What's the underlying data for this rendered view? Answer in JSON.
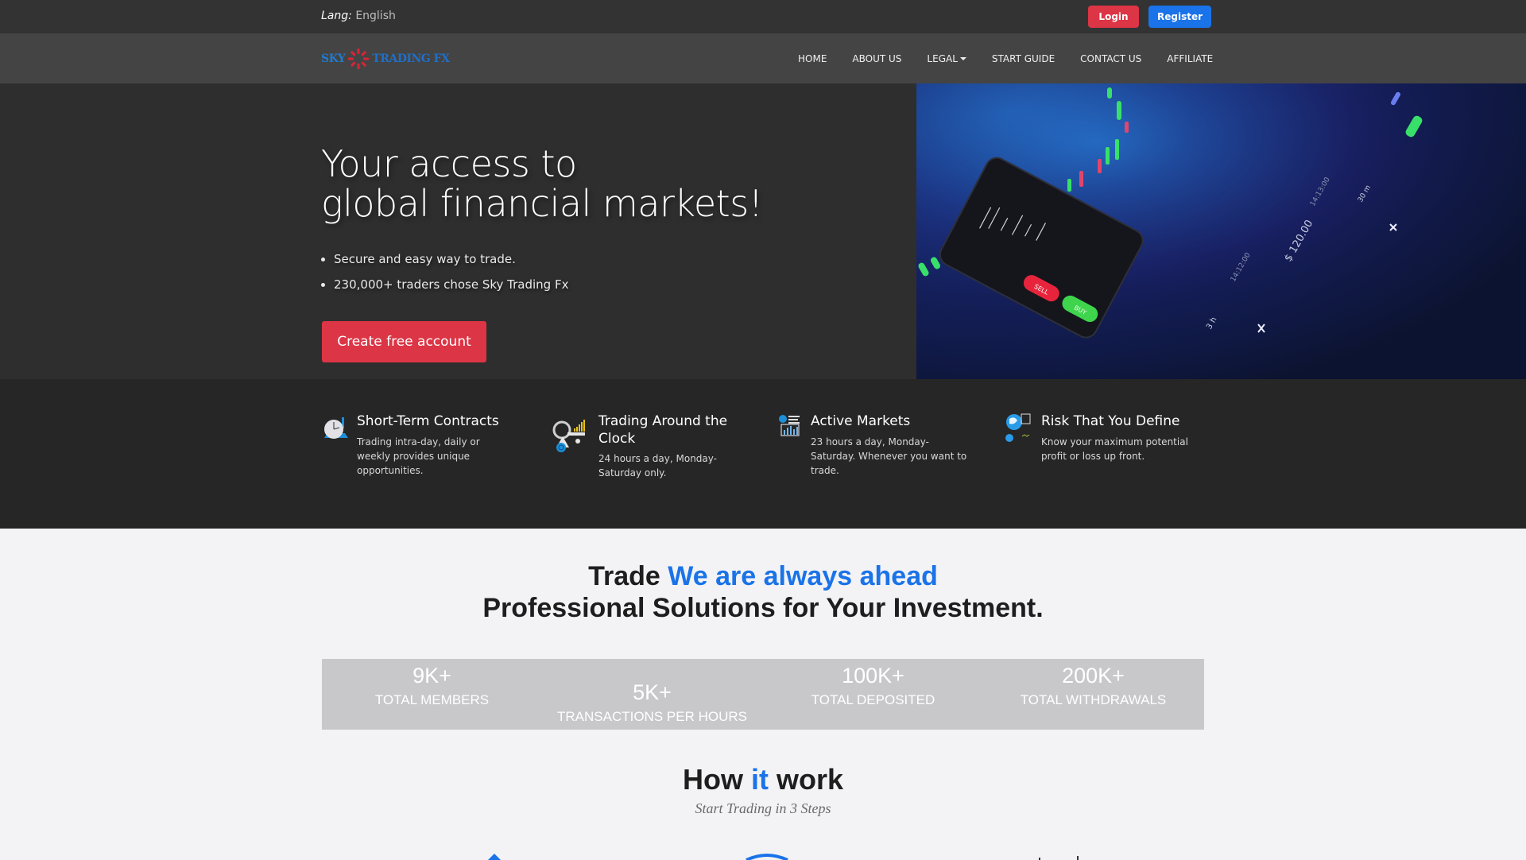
{
  "topbar": {
    "lang_label": "Lang:",
    "lang_value": "English",
    "login_label": "Login",
    "register_label": "Register"
  },
  "brand": {
    "logo_part1": "SKY",
    "logo_part2": "TRADING FX",
    "colors": {
      "primary": "#1a73e8",
      "danger": "#dc3545"
    }
  },
  "nav": {
    "items": [
      {
        "label": "HOME"
      },
      {
        "label": "ABOUT US"
      },
      {
        "label": "LEGAL",
        "has_dropdown": true
      },
      {
        "label": "START GUIDE"
      },
      {
        "label": "CONTACT US"
      },
      {
        "label": "AFFILIATE"
      }
    ]
  },
  "hero": {
    "title_line1": "Your access to",
    "title_line2": "global financial markets!",
    "bullets": [
      "Secure and easy way to trade.",
      "230,000+ traders chose Sky Trading Fx"
    ],
    "cta_label": "Create free account",
    "image_texts": {
      "sell": "SELL",
      "buy": "BUY",
      "price": "$ 120.00",
      "time1": "14:12:00",
      "time2": "14:13:00",
      "interval1": "3 h",
      "interval2": "30 m"
    }
  },
  "features": [
    {
      "icon": "clock-icon",
      "title": "Short-Term Contracts",
      "desc": "Trading intra-day, daily or weekly provides unique opportunities."
    },
    {
      "icon": "trading-clock-icon",
      "title": "Trading Around the Clock",
      "desc": "24 hours a day, Monday-Saturday only."
    },
    {
      "icon": "market-chart-icon",
      "title": "Active Markets",
      "desc": "23 hours a day, Monday-Saturday. Whenever you want to trade."
    },
    {
      "icon": "globe-risk-icon",
      "title": "Risk That You Define",
      "desc": "Know your maximum potential profit or loss up front."
    }
  ],
  "tagline": {
    "prefix": "Trade",
    "accent": "We are always ahead",
    "line2": "Professional Solutions for Your Investment."
  },
  "stats": [
    {
      "value": "9K+",
      "label": "TOTAL MEMBERS"
    },
    {
      "value": "5K+",
      "label": "TRANSACTIONS PER HOURS"
    },
    {
      "value": "100K+",
      "label": "TOTAL DEPOSITED"
    },
    {
      "value": "200K+",
      "label": "TOTAL WITHDRAWALS"
    }
  ],
  "how": {
    "title_prefix": "How",
    "title_accent": "it",
    "title_suffix": "work",
    "subtitle": "Start Trading in 3 Steps"
  }
}
